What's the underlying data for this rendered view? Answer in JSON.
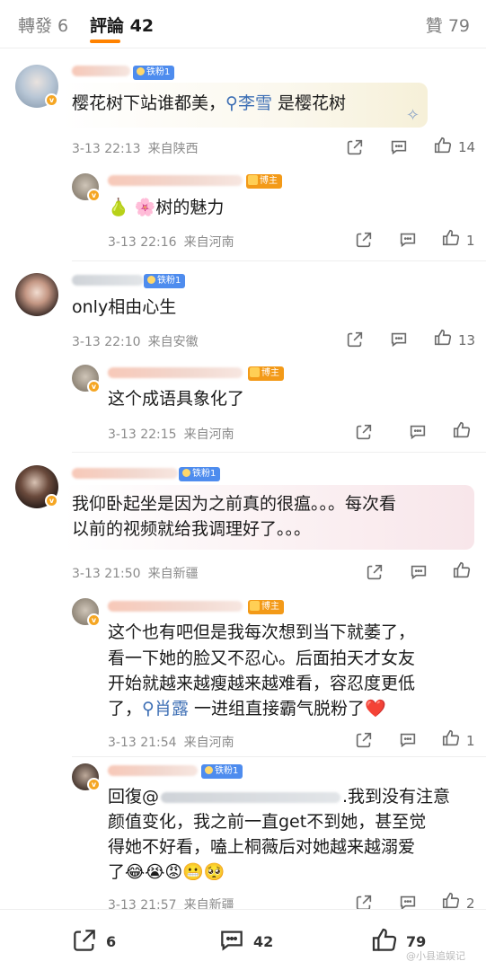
{
  "tabs": {
    "repost": "轉發 6",
    "comments": "評論 42",
    "likes": "贊 79"
  },
  "badges": {
    "iron_fan": "铁粉1",
    "blogger": "博主"
  },
  "comments": [
    {
      "text_before": "樱花树下站谁都美，",
      "mention": "李雪",
      "text_after": " 是樱花树",
      "time": "3-13 22:13",
      "location": "来自陕西",
      "likes": "14",
      "reply": {
        "text": "🍐 🌸树的魅力",
        "time": "3-13 22:16",
        "location": "来自河南",
        "likes": "1"
      }
    },
    {
      "text": "only相由心生",
      "time": "3-13 22:10",
      "location": "来自安徽",
      "likes": "13",
      "reply": {
        "text": "这个成语具象化了",
        "time": "3-13 22:15",
        "location": "来自河南"
      }
    },
    {
      "lines": [
        "我仰卧起坐是因为之前真的很瘟。。。每次看",
        "以前的视频就给我调理好了。。。"
      ],
      "time": "3-13 21:50",
      "location": "来自新疆",
      "replies": [
        {
          "lines": [
            "这个也有吧但是我每次想到当下就萎了，",
            "看一下她的脸又不忍心。后面拍天才女友",
            "开始就越来越瘦越来越难看，容忍度更低"
          ],
          "line4_before": "了，",
          "mention": "肖露",
          "line4_after": " 一进组直接霸气脱粉了❤️",
          "time": "3-13 21:54",
          "location": "来自河南",
          "likes": "1"
        },
        {
          "line1_before": "回復@",
          "line1_after": ".我到没有注意",
          "lines": [
            "颜值变化，我之前一直get不到她，甚至觉",
            "得她不好看，嗑上桐薇后对她越来越溺爱",
            "了😂😭😡😬🥺"
          ],
          "time": "3-13 21:57",
          "location": "来自新疆",
          "likes": "2"
        }
      ]
    }
  ],
  "bottom_bar": {
    "repost_count": "6",
    "comment_count": "42",
    "like_count": "79"
  },
  "watermark": "@小县追娱记",
  "colors": {
    "accent": "#ff8200",
    "link": "#3c6eb4",
    "fan_badge": "#4e8cee",
    "blogger_badge": "#f39a18"
  }
}
